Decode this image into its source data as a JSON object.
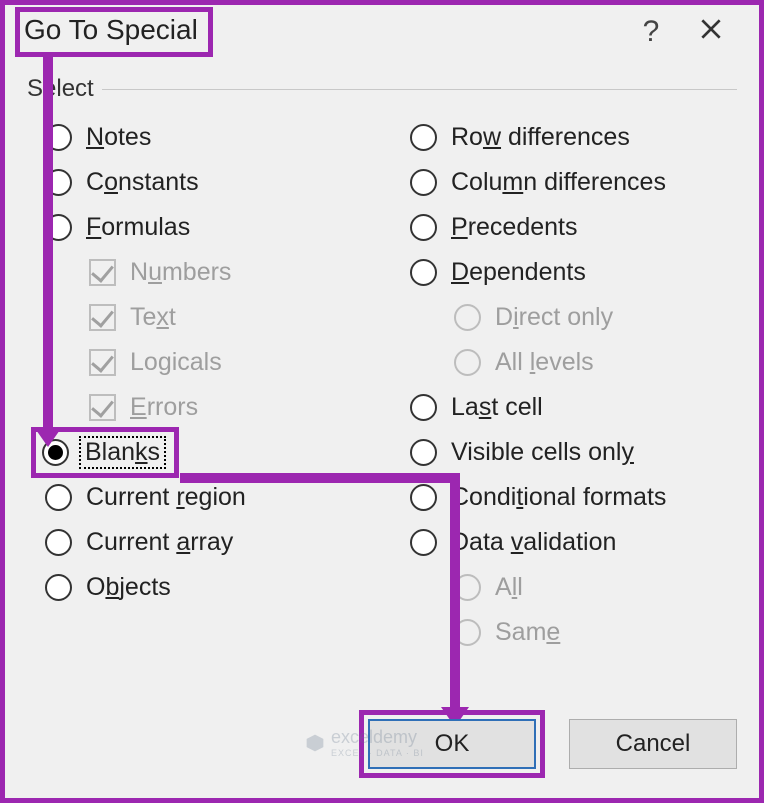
{
  "dialog": {
    "title": "Go To Special",
    "group_label": "Select",
    "help_symbol": "?"
  },
  "left_options": {
    "notes": {
      "pre": "",
      "u": "N",
      "post": "otes"
    },
    "constants": {
      "pre": "C",
      "u": "o",
      "post": "nstants"
    },
    "formulas": {
      "pre": "",
      "u": "F",
      "post": "ormulas"
    },
    "numbers": {
      "pre": "N",
      "u": "u",
      "post": "mbers"
    },
    "text": {
      "pre": "Te",
      "u": "x",
      "post": "t"
    },
    "logicals": {
      "pre": "Lo",
      "u": "g",
      "post": "icals"
    },
    "errors": {
      "pre": "",
      "u": "E",
      "post": "rrors"
    },
    "blanks": {
      "pre": "Blan",
      "u": "k",
      "post": "s"
    },
    "current_region": {
      "pre": "Current ",
      "u": "r",
      "post": "egion"
    },
    "current_array": {
      "pre": "Current ",
      "u": "a",
      "post": "rray"
    },
    "objects": {
      "pre": "O",
      "u": "b",
      "post": "jects"
    }
  },
  "right_options": {
    "row_diff": {
      "pre": "Ro",
      "u": "w",
      "post": " differences"
    },
    "col_diff": {
      "pre": "Colu",
      "u": "m",
      "post": "n differences"
    },
    "precedents": {
      "pre": "",
      "u": "P",
      "post": "recedents"
    },
    "dependents": {
      "pre": "",
      "u": "D",
      "post": "ependents"
    },
    "direct_only": {
      "pre": "D",
      "u": "i",
      "post": "rect only"
    },
    "all_levels": {
      "pre": "All ",
      "u": "l",
      "post": "evels"
    },
    "last_cell": {
      "pre": "La",
      "u": "s",
      "post": "t cell"
    },
    "visible_cells": {
      "pre": "Visible cells onl",
      "u": "y",
      "post": ""
    },
    "cond_formats": {
      "pre": "Condi",
      "u": "t",
      "post": "ional formats"
    },
    "data_validation": {
      "pre": "Data ",
      "u": "v",
      "post": "alidation"
    },
    "all": {
      "pre": "A",
      "u": "l",
      "post": "l"
    },
    "same": {
      "pre": "Sam",
      "u": "e",
      "post": ""
    }
  },
  "buttons": {
    "ok": "OK",
    "cancel": "Cancel"
  },
  "watermark": {
    "name": "exceldemy",
    "tagline": "EXCEL · DATA · BI"
  }
}
